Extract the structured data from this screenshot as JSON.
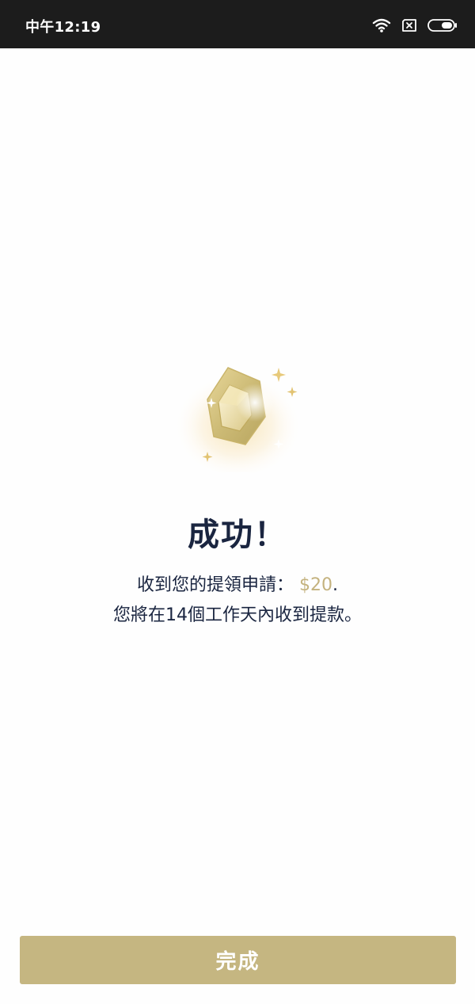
{
  "status_bar": {
    "time": "中午12:19",
    "icons": [
      "wifi-icon",
      "sim-x-icon",
      "battery-icon"
    ]
  },
  "success": {
    "icon": "gem-icon",
    "title": "成功！",
    "line1_prefix": "收到您的提領申請：",
    "amount": "$20",
    "line1_suffix": ".",
    "line2": "您將在14個工作天內收到提款。"
  },
  "footer": {
    "done_label": "完成"
  },
  "colors": {
    "accent_gold": "#c5b681",
    "amount_gold": "#c4b27e",
    "title_navy": "#1a2540",
    "status_bar_bg": "#1c1c1c"
  }
}
